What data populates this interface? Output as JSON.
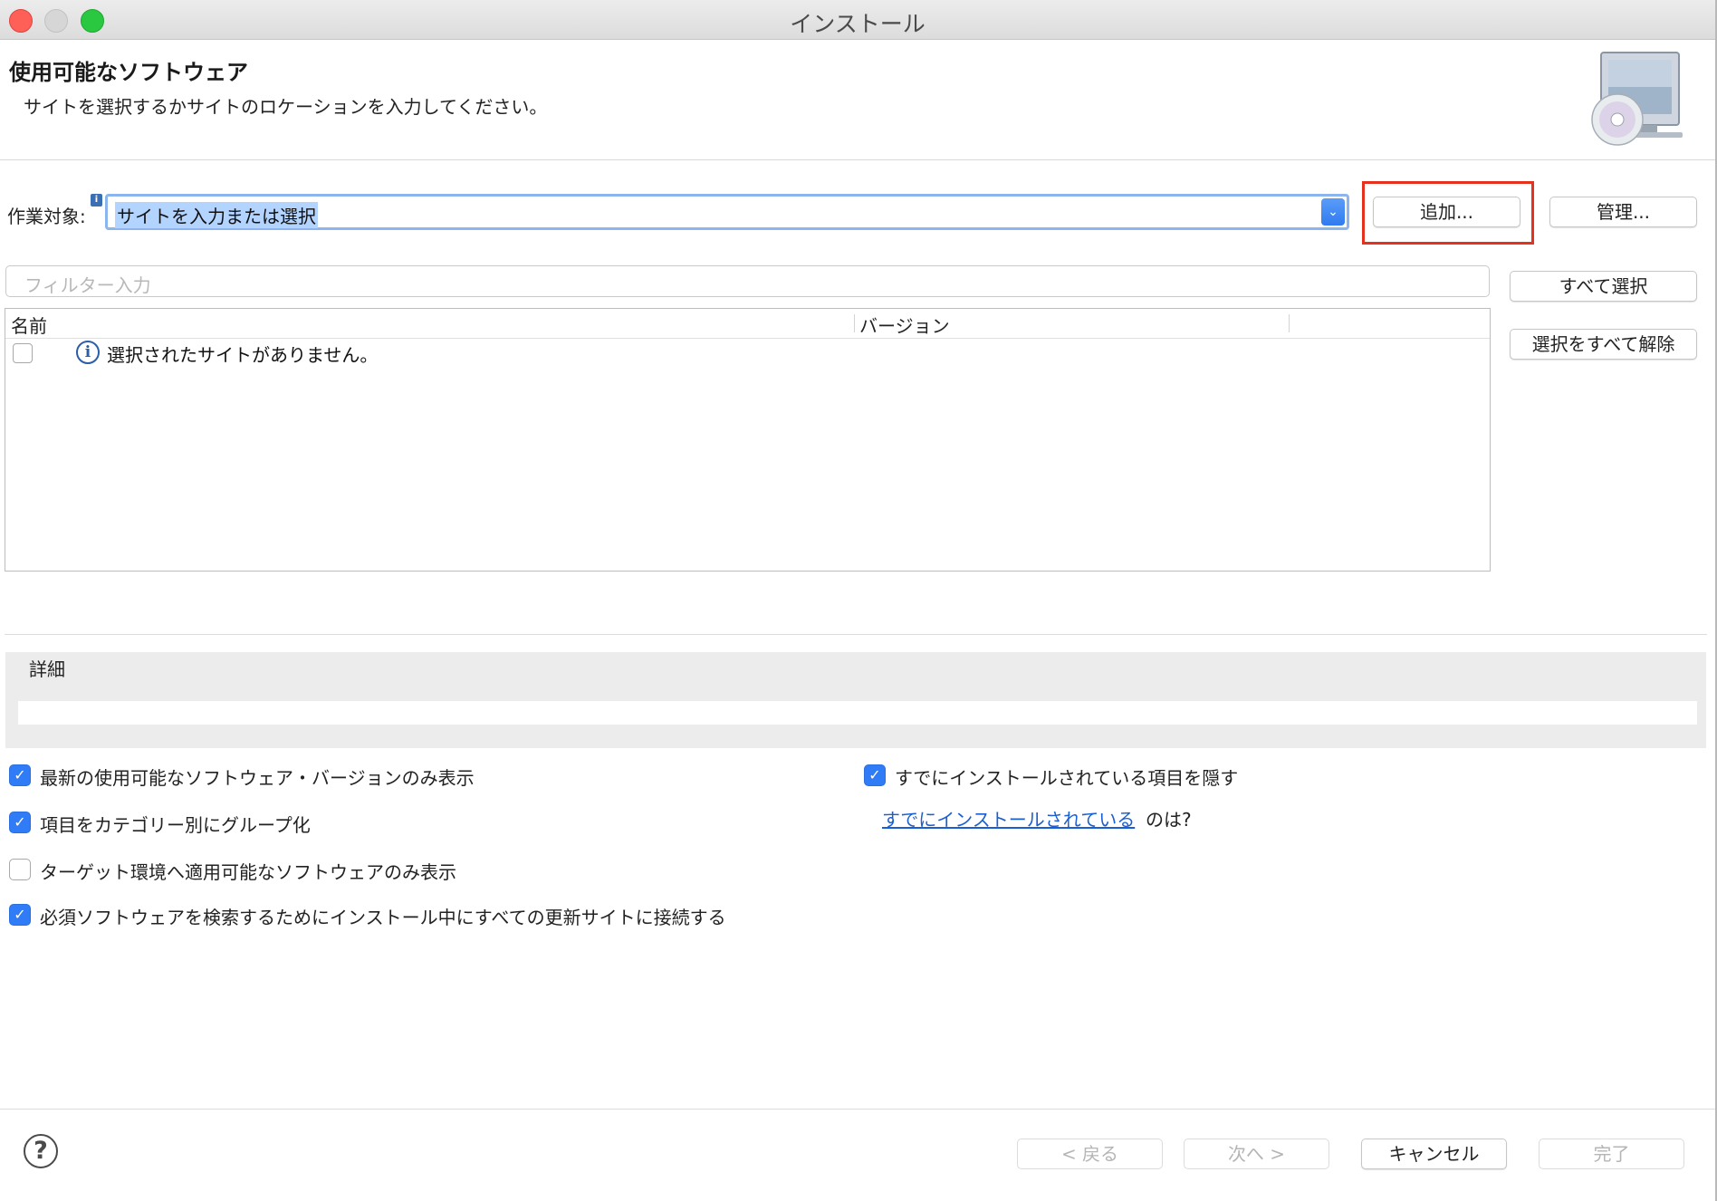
{
  "window": {
    "title": "インストール"
  },
  "header": {
    "title": "使用可能なソフトウェア",
    "description": "サイトを選択するかサイトのロケーションを入力してください。"
  },
  "work_with": {
    "label": "作業対象:",
    "info_marker": "i",
    "combo_value": "サイトを入力または選択",
    "add_button": "追加...",
    "manage_button": "管理..."
  },
  "filter": {
    "placeholder": "フィルター入力"
  },
  "side_buttons": {
    "select_all": "すべて選択",
    "deselect_all": "選択をすべて解除"
  },
  "table": {
    "columns": [
      "名前",
      "バージョン"
    ],
    "rows": [
      {
        "checked": false,
        "icon": "info-icon",
        "text": "選択されたサイトがありません。"
      }
    ]
  },
  "details": {
    "label": "詳細"
  },
  "options": {
    "latest_only": {
      "label": "最新の使用可能なソフトウェア・バージョンのみ表示",
      "checked": true
    },
    "group_by_category": {
      "label": "項目をカテゴリー別にグループ化",
      "checked": true
    },
    "target_env_only": {
      "label": "ターゲット環境へ適用可能なソフトウェアのみ表示",
      "checked": false
    },
    "contact_all_sites": {
      "label": "必須ソフトウェアを検索するためにインストール中にすべての更新サイトに接続する",
      "checked": true
    },
    "hide_installed": {
      "label": "すでにインストールされている項目を隠す",
      "checked": true
    },
    "what_installed_link": "すでにインストールされている",
    "what_installed_suffix": "のは?"
  },
  "footer": {
    "help_icon": "?",
    "back_button": "< 戻る",
    "next_button": "次へ >",
    "cancel_button": "キャンセル",
    "finish_button": "完了"
  },
  "colors": {
    "accent": "#2f7cf6",
    "highlight": "#e5321f",
    "link": "#1a5fd1"
  }
}
